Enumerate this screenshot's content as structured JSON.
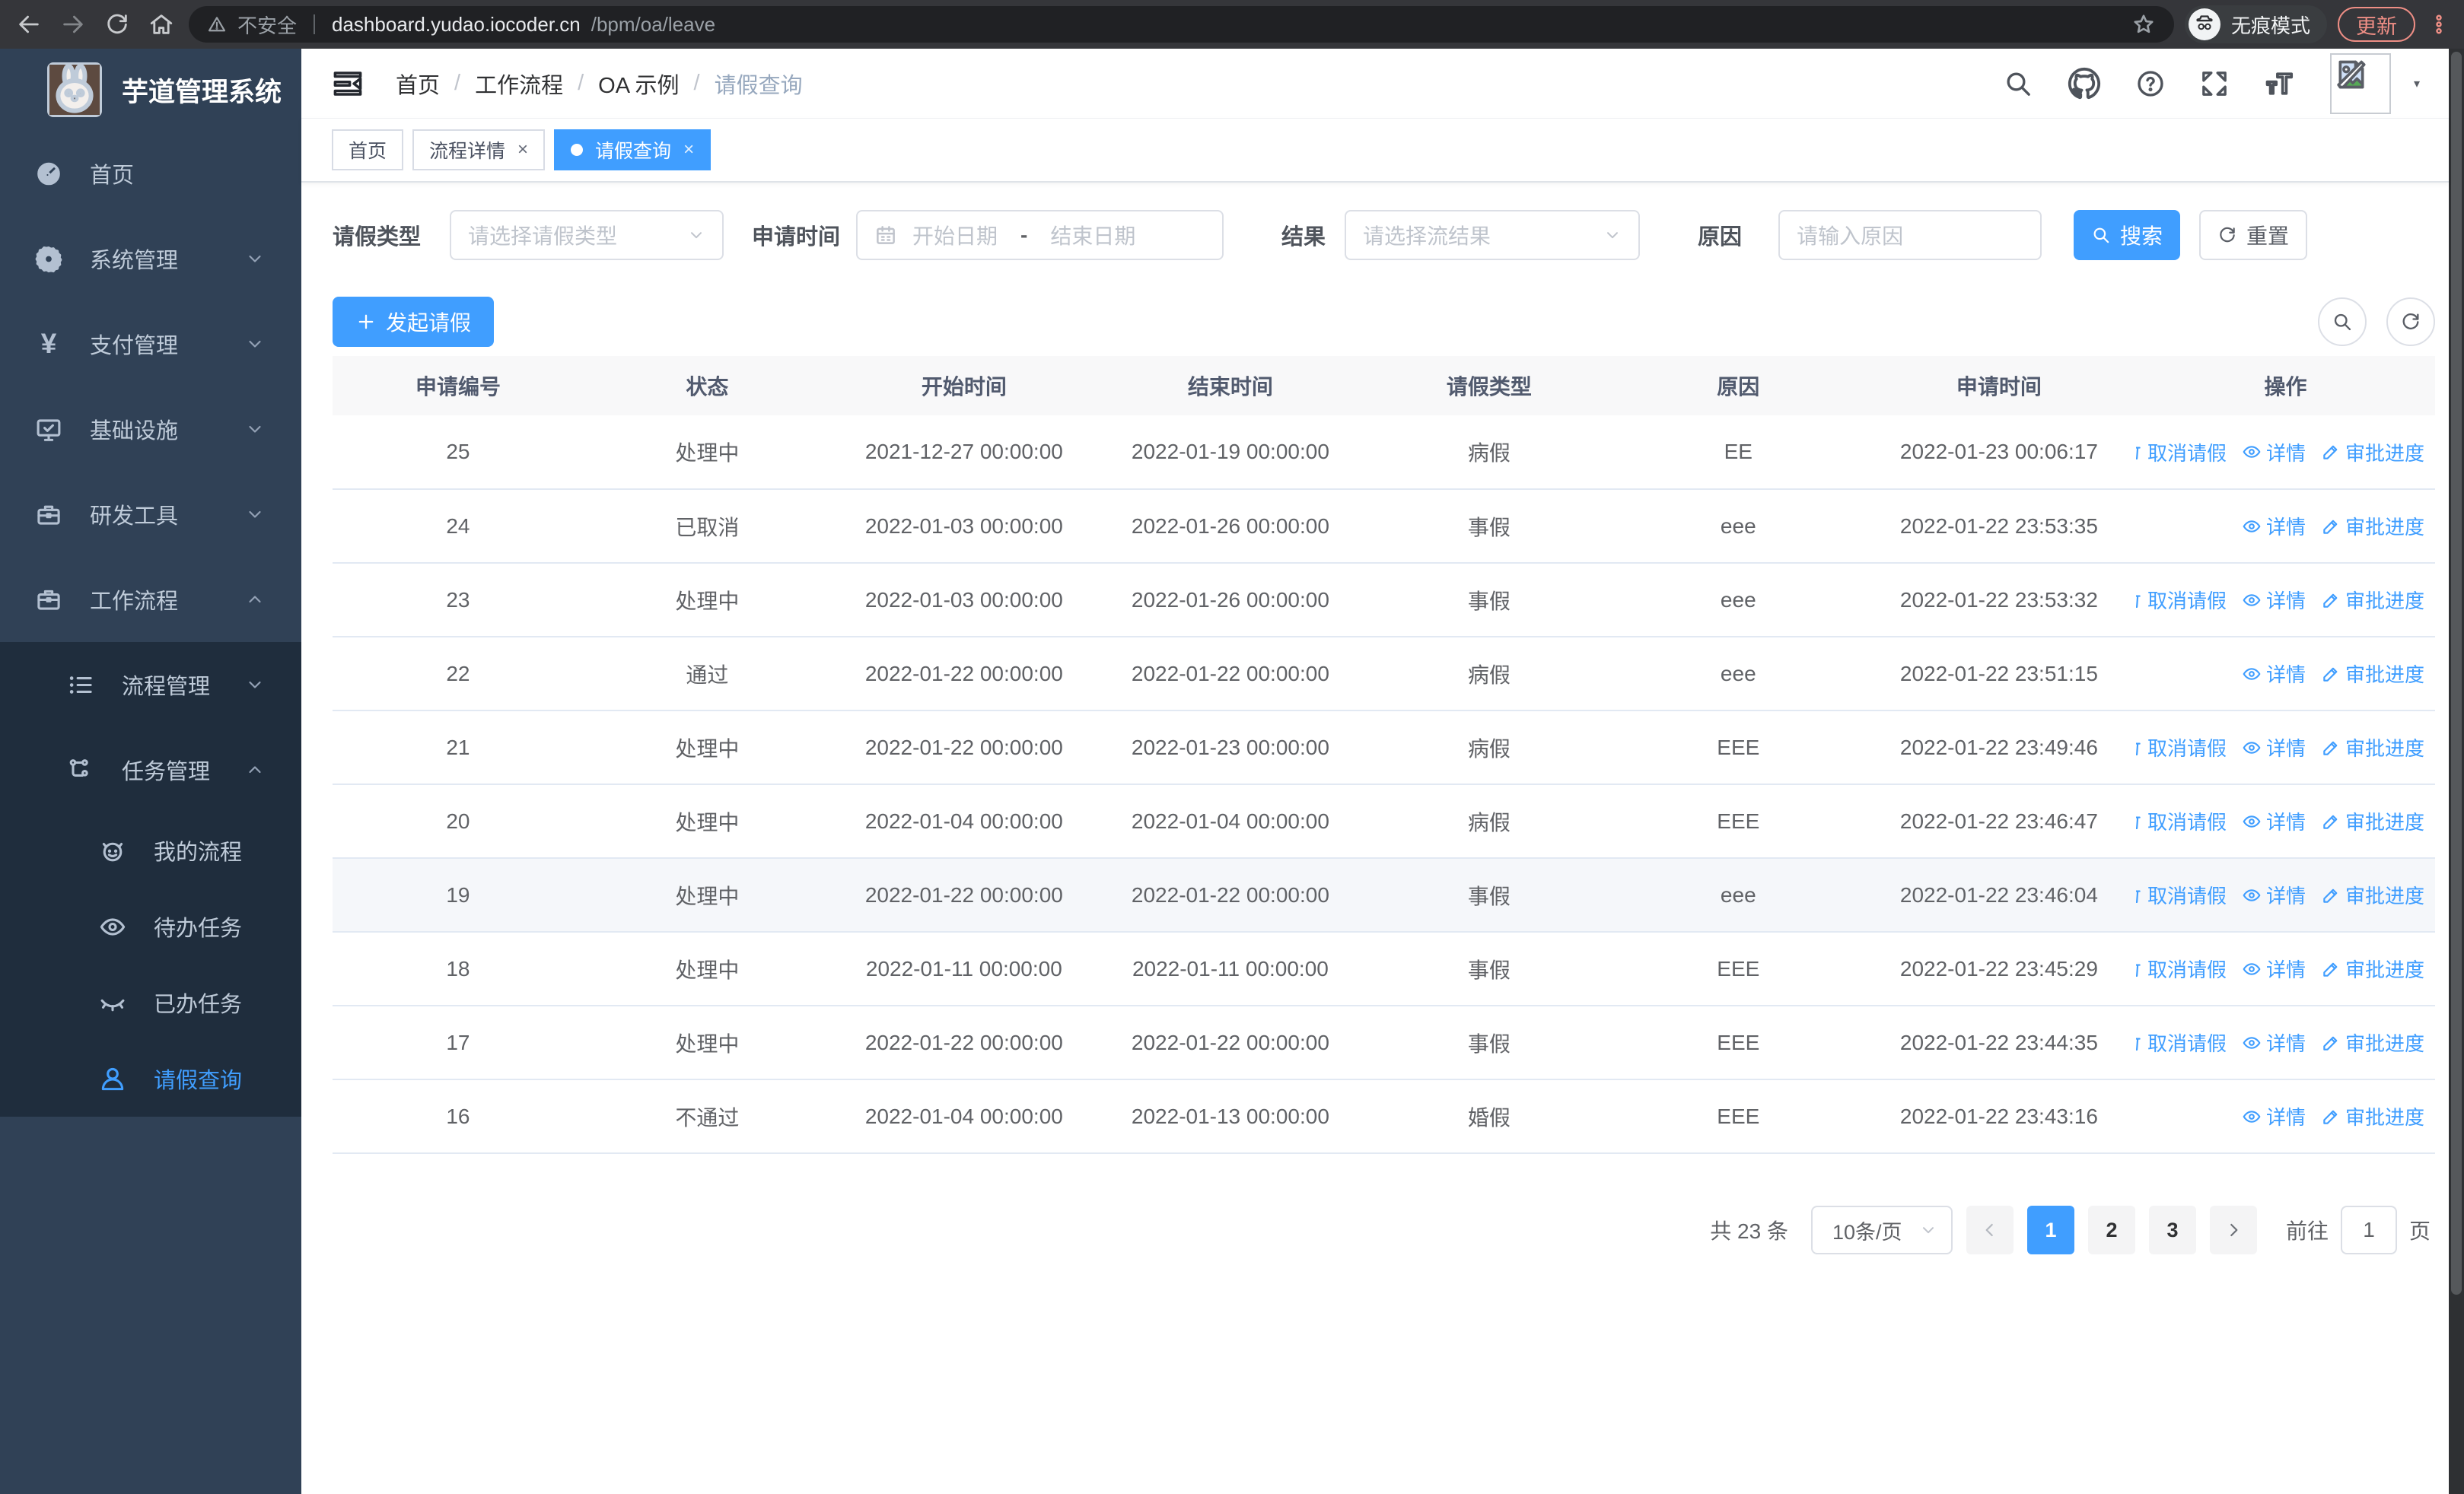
{
  "colors": {
    "primary": "#409eff",
    "sidebar_bg": "#304156",
    "submenu_bg": "#1f2d3d",
    "update_accent": "#ee8e85"
  },
  "browser": {
    "security_warning": "不安全",
    "url_host": "dashboard.yudao.iocoder.cn",
    "url_path": "/bpm/oa/leave",
    "incognito_label": "无痕模式",
    "update_label": "更新"
  },
  "sidebar": {
    "app_title": "芋道管理系统",
    "items": [
      {
        "label": "首页",
        "icon": "dashboard",
        "level": 0,
        "chevron": "",
        "sub": false,
        "active": false
      },
      {
        "label": "系统管理",
        "icon": "gear",
        "level": 0,
        "chevron": "down",
        "sub": false,
        "active": false
      },
      {
        "label": "支付管理",
        "icon": "yen",
        "level": 0,
        "chevron": "down",
        "sub": false,
        "active": false
      },
      {
        "label": "基础设施",
        "icon": "monitor",
        "level": 0,
        "chevron": "down",
        "sub": false,
        "active": false
      },
      {
        "label": "研发工具",
        "icon": "toolbox",
        "level": 0,
        "chevron": "down",
        "sub": false,
        "active": false
      },
      {
        "label": "工作流程",
        "icon": "briefcase",
        "level": 0,
        "chevron": "up",
        "sub": false,
        "active": false
      },
      {
        "label": "流程管理",
        "icon": "tree-list",
        "level": 1,
        "chevron": "down",
        "sub": true,
        "active": false
      },
      {
        "label": "任务管理",
        "icon": "workflow",
        "level": 1,
        "chevron": "up",
        "sub": true,
        "active": false
      },
      {
        "label": "我的流程",
        "icon": "robot",
        "level": 2,
        "chevron": "",
        "sub": true,
        "active": false
      },
      {
        "label": "待办任务",
        "icon": "eye",
        "level": 2,
        "chevron": "",
        "sub": true,
        "active": false
      },
      {
        "label": "已办任务",
        "icon": "eye-off",
        "level": 2,
        "chevron": "",
        "sub": true,
        "active": false
      },
      {
        "label": "请假查询",
        "icon": "user",
        "level": 2,
        "chevron": "",
        "sub": true,
        "active": true
      }
    ]
  },
  "header": {
    "breadcrumb": [
      "首页",
      "工作流程",
      "OA 示例",
      "请假查询"
    ]
  },
  "tabs": [
    {
      "label": "首页",
      "closable": false,
      "active": false
    },
    {
      "label": "流程详情",
      "closable": true,
      "active": false
    },
    {
      "label": "请假查询",
      "closable": true,
      "active": true
    }
  ],
  "filters": {
    "leave_type_label": "请假类型",
    "leave_type_placeholder": "请选择请假类型",
    "apply_time_label": "申请时间",
    "date_start_placeholder": "开始日期",
    "date_separator": "-",
    "date_end_placeholder": "结束日期",
    "result_label": "结果",
    "result_placeholder": "请选择流结果",
    "reason_label": "原因",
    "reason_placeholder": "请输入原因",
    "search_label": "搜索",
    "reset_label": "重置"
  },
  "toolbar": {
    "create_label": "发起请假"
  },
  "table": {
    "columns": [
      "申请编号",
      "状态",
      "开始时间",
      "结束时间",
      "请假类型",
      "原因",
      "申请时间",
      "操作"
    ],
    "action_labels": {
      "cancel": "取消请假",
      "detail": "详情",
      "progress": "审批进度"
    },
    "rows": [
      {
        "id": "25",
        "status": "处理中",
        "start": "2021-12-27 00:00:00",
        "end": "2022-01-19 00:00:00",
        "type": "病假",
        "reason": "EE",
        "applied": "2022-01-23 00:06:17",
        "actions": [
          "cancel",
          "detail",
          "progress"
        ],
        "highlight": false
      },
      {
        "id": "24",
        "status": "已取消",
        "start": "2022-01-03 00:00:00",
        "end": "2022-01-26 00:00:00",
        "type": "事假",
        "reason": "eee",
        "applied": "2022-01-22 23:53:35",
        "actions": [
          "detail",
          "progress"
        ],
        "highlight": false
      },
      {
        "id": "23",
        "status": "处理中",
        "start": "2022-01-03 00:00:00",
        "end": "2022-01-26 00:00:00",
        "type": "事假",
        "reason": "eee",
        "applied": "2022-01-22 23:53:32",
        "actions": [
          "cancel",
          "detail",
          "progress"
        ],
        "highlight": false
      },
      {
        "id": "22",
        "status": "通过",
        "start": "2022-01-22 00:00:00",
        "end": "2022-01-22 00:00:00",
        "type": "病假",
        "reason": "eee",
        "applied": "2022-01-22 23:51:15",
        "actions": [
          "detail",
          "progress"
        ],
        "highlight": false
      },
      {
        "id": "21",
        "status": "处理中",
        "start": "2022-01-22 00:00:00",
        "end": "2022-01-23 00:00:00",
        "type": "病假",
        "reason": "EEE",
        "applied": "2022-01-22 23:49:46",
        "actions": [
          "cancel",
          "detail",
          "progress"
        ],
        "highlight": false
      },
      {
        "id": "20",
        "status": "处理中",
        "start": "2022-01-04 00:00:00",
        "end": "2022-01-04 00:00:00",
        "type": "病假",
        "reason": "EEE",
        "applied": "2022-01-22 23:46:47",
        "actions": [
          "cancel",
          "detail",
          "progress"
        ],
        "highlight": false
      },
      {
        "id": "19",
        "status": "处理中",
        "start": "2022-01-22 00:00:00",
        "end": "2022-01-22 00:00:00",
        "type": "事假",
        "reason": "eee",
        "applied": "2022-01-22 23:46:04",
        "actions": [
          "cancel",
          "detail",
          "progress"
        ],
        "highlight": true
      },
      {
        "id": "18",
        "status": "处理中",
        "start": "2022-01-11 00:00:00",
        "end": "2022-01-11 00:00:00",
        "type": "事假",
        "reason": "EEE",
        "applied": "2022-01-22 23:45:29",
        "actions": [
          "cancel",
          "detail",
          "progress"
        ],
        "highlight": false
      },
      {
        "id": "17",
        "status": "处理中",
        "start": "2022-01-22 00:00:00",
        "end": "2022-01-22 00:00:00",
        "type": "事假",
        "reason": "EEE",
        "applied": "2022-01-22 23:44:35",
        "actions": [
          "cancel",
          "detail",
          "progress"
        ],
        "highlight": false
      },
      {
        "id": "16",
        "status": "不通过",
        "start": "2022-01-04 00:00:00",
        "end": "2022-01-13 00:00:00",
        "type": "婚假",
        "reason": "EEE",
        "applied": "2022-01-22 23:43:16",
        "actions": [
          "detail",
          "progress"
        ],
        "highlight": false
      }
    ]
  },
  "pagination": {
    "total_text": "共 23 条",
    "page_size": "10条/页",
    "pages": [
      "1",
      "2",
      "3"
    ],
    "active_page": "1",
    "goto_label": "前往",
    "goto_value": "1",
    "page_unit": "页"
  }
}
